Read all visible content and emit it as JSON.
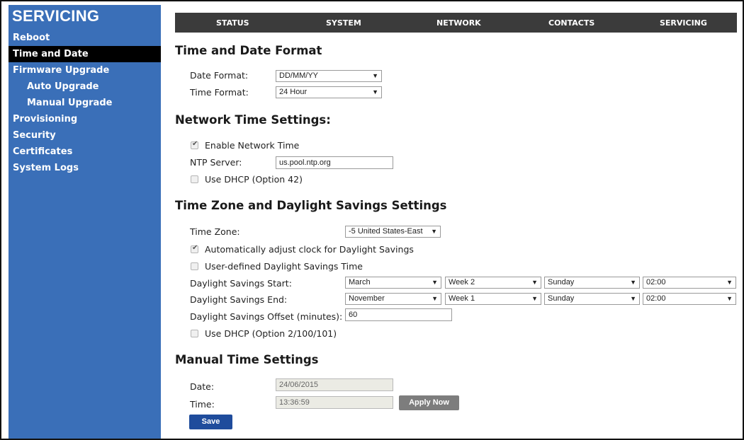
{
  "sidebar": {
    "title": "SERVICING",
    "items": [
      {
        "label": "Reboot"
      },
      {
        "label": "Time and Date"
      },
      {
        "label": "Firmware Upgrade"
      },
      {
        "label": "Auto Upgrade"
      },
      {
        "label": "Manual Upgrade"
      },
      {
        "label": "Provisioning"
      },
      {
        "label": "Security"
      },
      {
        "label": "Certificates"
      },
      {
        "label": "System Logs"
      }
    ],
    "active_item": "Time and Date",
    "color": "#3a6fb8"
  },
  "topnav": {
    "tabs": [
      {
        "label": "STATUS"
      },
      {
        "label": "SYSTEM"
      },
      {
        "label": "NETWORK"
      },
      {
        "label": "CONTACTS"
      },
      {
        "label": "SERVICING"
      }
    ]
  },
  "sections": {
    "format": {
      "title": "Time and Date Format",
      "date_format_label": "Date Format:",
      "date_format_value": "DD/MM/YY",
      "time_format_label": "Time Format:",
      "time_format_value": "24 Hour"
    },
    "network": {
      "title": "Network Time Settings:",
      "enable_label": "Enable Network Time",
      "enable_checked": true,
      "ntp_label": "NTP Server:",
      "ntp_value": "us.pool.ntp.org",
      "dhcp_label": "Use DHCP (Option 42)",
      "dhcp_checked": false
    },
    "timezone": {
      "title": "Time Zone and Daylight Savings Settings",
      "tz_label": "Time Zone:",
      "tz_value": "-5 United States-East",
      "auto_label": "Automatically adjust clock for Daylight Savings",
      "auto_checked": true,
      "user_label": "User-defined Daylight Savings Time",
      "user_checked": false,
      "start_label": "Daylight Savings Start:",
      "start": {
        "month": "March",
        "week": "Week 2",
        "day": "Sunday",
        "time": "02:00"
      },
      "end_label": "Daylight Savings End:",
      "end": {
        "month": "November",
        "week": "Week 1",
        "day": "Sunday",
        "time": "02:00"
      },
      "offset_label": "Daylight Savings Offset (minutes):",
      "offset_value": "60",
      "dhcp_label": "Use DHCP (Option 2/100/101)",
      "dhcp_checked": false
    },
    "manual": {
      "title": "Manual Time Settings",
      "date_label": "Date:",
      "date_value": "24/06/2015",
      "time_label": "Time:",
      "time_value": "13:36:59",
      "apply_label": "Apply Now",
      "save_label": "Save"
    }
  }
}
